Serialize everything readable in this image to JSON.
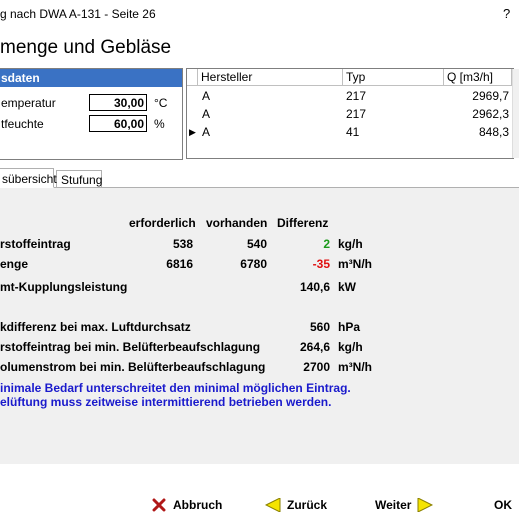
{
  "window": {
    "title": "g nach DWA A-131 - Seite 26",
    "help": "?"
  },
  "page_title": "menge und Gebläse",
  "input_panel": {
    "header": "sdaten",
    "temperature_label": "emperatur",
    "temperature_value": "30,00",
    "temperature_unit": "°C",
    "humidity_label": "tfeuchte",
    "humidity_value": "60,00",
    "humidity_unit": "%"
  },
  "blower_table": {
    "headers": [
      "Hersteller",
      "Typ",
      "Q [m3/h]"
    ],
    "rows": [
      {
        "hersteller": "A",
        "typ": "217",
        "q": "2969,7"
      },
      {
        "hersteller": "A",
        "typ": "217",
        "q": "2962,3"
      },
      {
        "hersteller": "A",
        "typ": "41",
        "q": "848,3"
      }
    ]
  },
  "tabs": [
    "sübersicht",
    "Stufung"
  ],
  "summary": {
    "col_headers": [
      "erforderlich",
      "vorhanden",
      "Differenz"
    ],
    "rows": [
      {
        "label": "rstoffeintrag",
        "req": "538",
        "avail": "540",
        "diff": "2",
        "unit": "kg/h"
      },
      {
        "label": "enge",
        "req": "6816",
        "avail": "6780",
        "diff": "-35",
        "unit": "m³N/h"
      }
    ],
    "coupling_label": "mt-Kupplungsleistung",
    "coupling_value": "140,6",
    "coupling_unit": "kW",
    "details": [
      {
        "label": "kdifferenz bei max. Luftdurchsatz",
        "value": "560",
        "unit": "hPa"
      },
      {
        "label": "rstoffeintrag bei min. Belüfterbeaufschlagung",
        "value": "264,6",
        "unit": "kg/h"
      },
      {
        "label": "olumenstrom bei min. Belüfterbeaufschlagung",
        "value": "2700",
        "unit": "m³N/h"
      }
    ],
    "message_line1": "inimale Bedarf unterschreitet den minimal möglichen Eintrag.",
    "message_line2": "elüftung muss zeitweise intermittierend betrieben werden."
  },
  "footer": {
    "abbruch": "Abbruch",
    "zurueck": "Zurück",
    "weiter": "Weiter",
    "ok": "OK"
  },
  "colors": {
    "header_blue": "#3a72c4",
    "message_blue": "#1a1acc",
    "positive": "#1a9a1a",
    "negative": "#e01010"
  }
}
